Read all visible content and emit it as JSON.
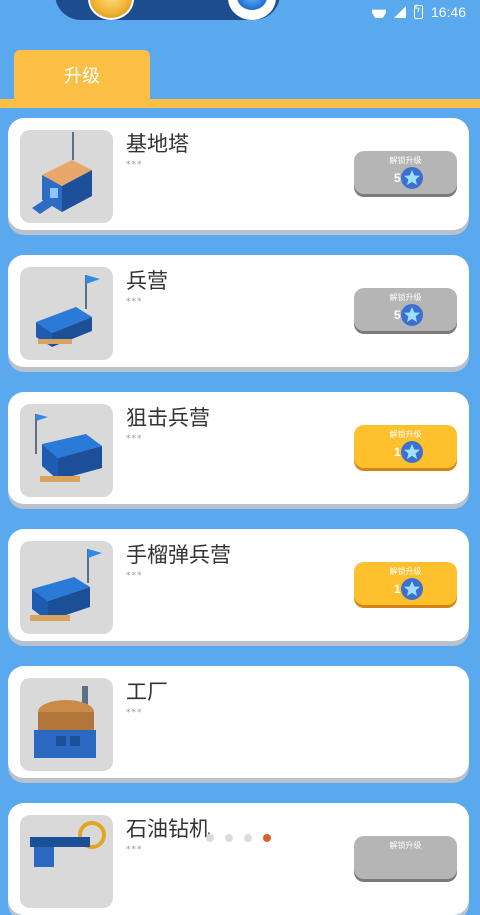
{
  "status": {
    "time": "16:46",
    "icons": [
      "wifi-icon",
      "signal-icon",
      "battery-icon"
    ]
  },
  "header": {
    "currency_icons": [
      "coin-icon",
      "gem-icon"
    ]
  },
  "tabs": [
    {
      "label": "升级"
    }
  ],
  "buildings": [
    {
      "name": "基地塔",
      "sub": "***",
      "unlock_label": "解锁升级",
      "level": "5",
      "state": "locked"
    },
    {
      "name": "兵营",
      "sub": "***",
      "unlock_label": "解锁升级",
      "level": "5",
      "state": "locked"
    },
    {
      "name": "狙击兵营",
      "sub": "***",
      "unlock_label": "解锁升级",
      "level": "1",
      "state": "available"
    },
    {
      "name": "手榴弹兵营",
      "sub": "***",
      "unlock_label": "解锁升级",
      "level": "1",
      "state": "available"
    },
    {
      "name": "工厂",
      "sub": "***"
    },
    {
      "name": "石油钻机",
      "sub": "***",
      "unlock_label": "解锁升级",
      "state": "locked"
    }
  ],
  "pagination": {
    "count": 4,
    "active": 4
  },
  "colors": {
    "background": "#5aa8ee",
    "accent": "#fcbf45",
    "locked": "#b5b5b5",
    "available": "#ffc02e"
  }
}
